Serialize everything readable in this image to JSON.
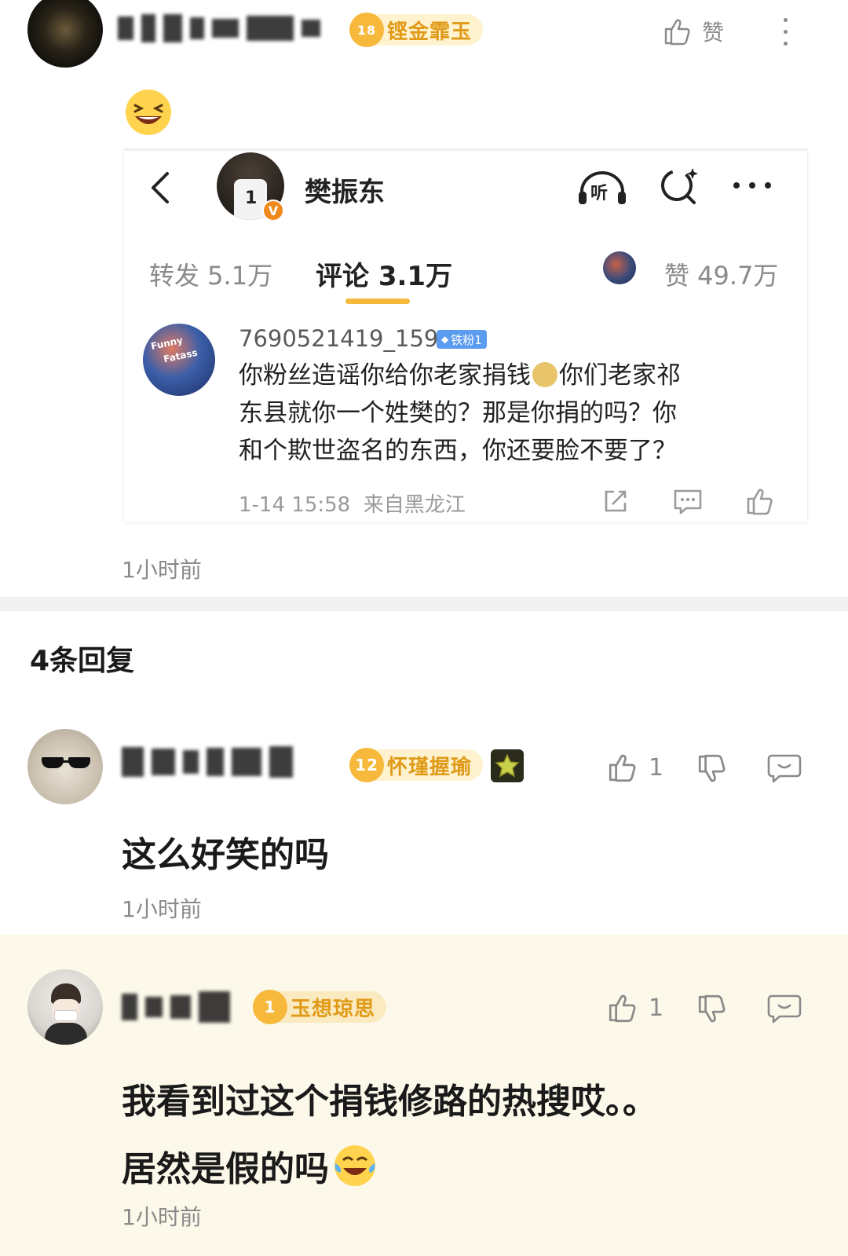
{
  "comment": {
    "badge": "铿金霏玉",
    "like_label": "赞",
    "time": "1小时前",
    "embedded": {
      "account_name": "樊振东",
      "listen_label": "听",
      "tabs": {
        "repost": "转发 5.1万",
        "comments": "评论 3.1万",
        "likes": "赞 49.7万"
      },
      "inner_comment": {
        "user": "7690521419_159",
        "fan_badge": "铁粉1",
        "text_lines": [
          "你粉丝造谣你给你老家捐钱",
          "你们老家祁",
          "东县就你一个姓樊的？那是你捐的吗？你",
          "和个欺世盗名的东西，你还要脸不要了？"
        ],
        "meta": "1-14 15:58  来自黑龙江"
      }
    }
  },
  "replies_header": "4条回复",
  "replies": [
    {
      "level": "12",
      "badge": "怀瑾握瑜",
      "text": "这么好笑的吗",
      "time": "1小时前",
      "likes": "1"
    },
    {
      "level": "1",
      "badge": "玉想琼思",
      "text_line1": "我看到过这个捐钱修路的热搜哎。。",
      "text_line2": "居然是假的吗",
      "time": "1小时前",
      "likes": "1"
    }
  ],
  "colors": {
    "accent_orange": "#f6b93b",
    "badge_text": "#e09a17",
    "muted_text": "#8a8a8a",
    "highlight_bg": "#fcf9ea",
    "verified": "#f08a1c"
  }
}
